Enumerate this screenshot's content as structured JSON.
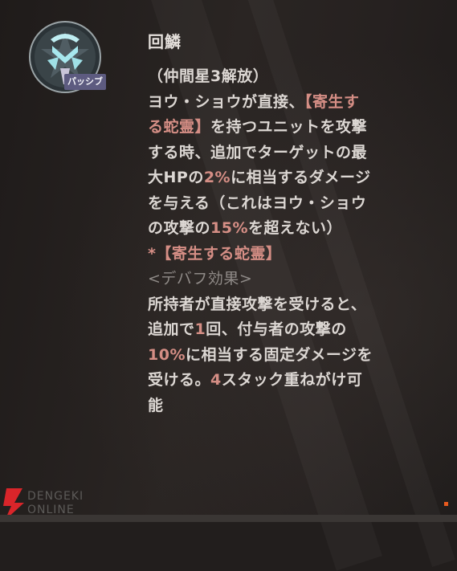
{
  "skill": {
    "name": "回鱗",
    "type_badge": "パッシブ",
    "unlock": "（仲間星3解放）",
    "desc_line1_a": "ヨウ・ショウが直接、",
    "desc_line1_hl": "【寄生す",
    "desc_line2_hl": "る蛇霊】",
    "desc_line2_b": "を持つユニットを攻撃",
    "desc_line3": "する時、追加でターゲットの最",
    "desc_line4_a": "大HPの",
    "desc_line4_hl": "2%",
    "desc_line4_b": "に相当するダメージ",
    "desc_line5": "を与える（これはヨウ・ショウ",
    "desc_line6_a": "の攻撃の",
    "desc_line6_hl": "15%",
    "desc_line6_b": "を超えない）",
    "note_title": "*【寄生する蛇霊】",
    "note_tag": "<デバフ効果>",
    "note_line1": "所持者が直接攻撃を受けると、",
    "note_line2_a": "追加で",
    "note_line2_hl": "1",
    "note_line2_b": "回、付与者の攻撃の",
    "note_line3_hl": "10%",
    "note_line3_b": "に相当する固定ダメージを",
    "note_line4_a": "受ける。",
    "note_line4_hl": "4",
    "note_line4_b": "スタック重ねがけ可",
    "note_line5": "能"
  },
  "watermark": {
    "line1": "DENGEKI",
    "line2": "ONLINE"
  },
  "colors": {
    "highlight": "#d58e85",
    "text": "#dcd7d3",
    "badge": "#5d5b80"
  }
}
